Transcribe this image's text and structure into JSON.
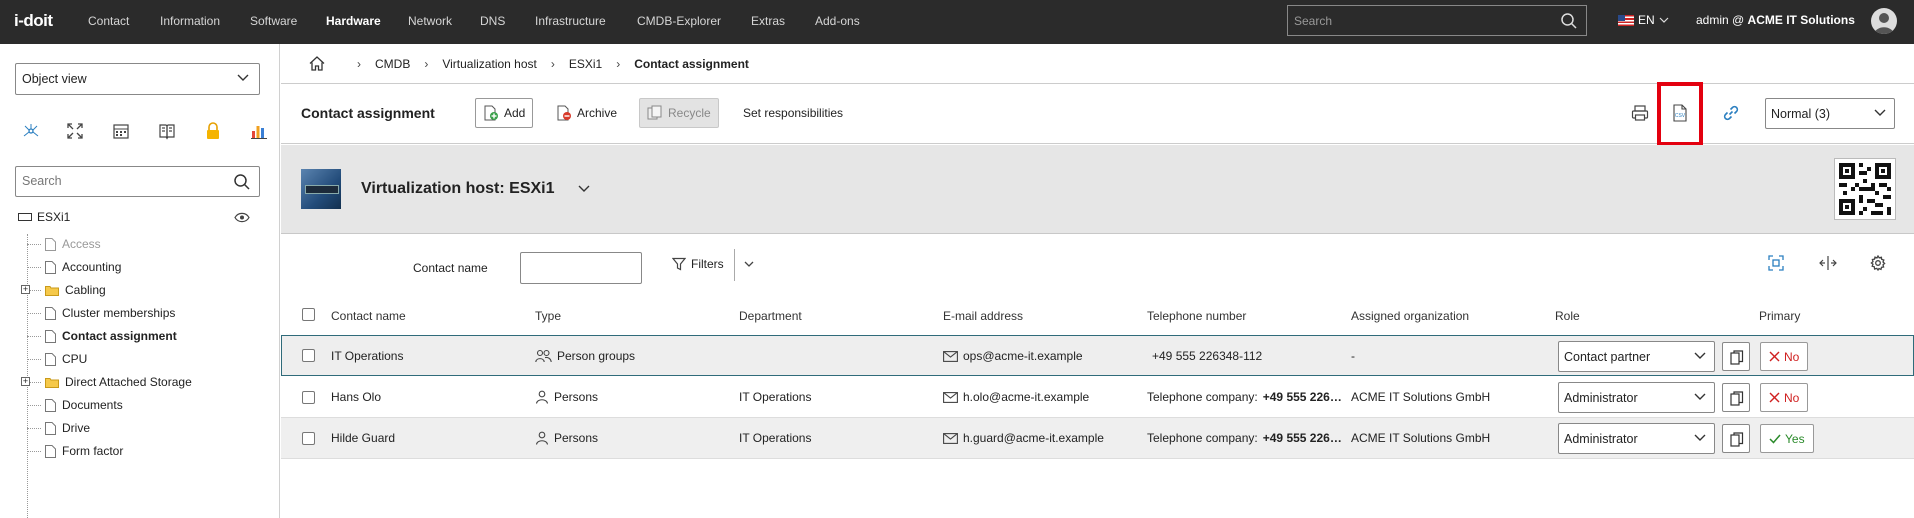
{
  "app": {
    "logo_text": "i-doit"
  },
  "nav": {
    "items": [
      "Contact",
      "Information",
      "Software",
      "Hardware",
      "Network",
      "DNS",
      "Infrastructure",
      "CMDB-Explorer",
      "Extras",
      "Add-ons"
    ],
    "active": "Hardware",
    "search_placeholder": "Search",
    "language": "EN",
    "user_prefix": "admin @",
    "tenant": "ACME IT Solutions"
  },
  "sidebar": {
    "view_select": "Object view",
    "search_placeholder": "Search",
    "root": "ESXi1",
    "items": [
      {
        "label": "Access",
        "state": "grey"
      },
      {
        "label": "Accounting",
        "state": "normal"
      },
      {
        "label": "Cabling",
        "state": "folder"
      },
      {
        "label": "Cluster memberships",
        "state": "normal"
      },
      {
        "label": "Contact assignment",
        "state": "bold"
      },
      {
        "label": "CPU",
        "state": "normal"
      },
      {
        "label": "Direct Attached Storage",
        "state": "folder"
      },
      {
        "label": "Documents",
        "state": "normal"
      },
      {
        "label": "Drive",
        "state": "normal"
      },
      {
        "label": "Form factor",
        "state": "normal"
      }
    ]
  },
  "breadcrumb": [
    "CMDB",
    "Virtualization host",
    "ESXi1",
    "Contact assignment"
  ],
  "toolbar": {
    "title": "Contact assignment",
    "add": "Add",
    "archive": "Archive",
    "recycle": "Recycle",
    "set_responsibilities": "Set responsibilities",
    "csv_label": "CSV",
    "mode": "Normal (3)"
  },
  "object": {
    "title": "Virtualization host: ESXi1"
  },
  "filter": {
    "label": "Contact name",
    "value": "",
    "filters_label": "Filters"
  },
  "table": {
    "columns": [
      "Contact name",
      "Type",
      "Department",
      "E-mail address",
      "Telephone number",
      "Assigned organization",
      "Role",
      "Primary"
    ],
    "rows": [
      {
        "name": "IT Operations",
        "type": "Person groups",
        "department": "",
        "email": "ops@acme-it.example",
        "phone_prefix": "",
        "phone": "+49 555 226348-112",
        "org": "-",
        "role": "Contact partner",
        "primary": "No"
      },
      {
        "name": "Hans Olo",
        "type": "Persons",
        "department": "IT Operations",
        "email": "h.olo@acme-it.example",
        "phone_prefix": "Telephone company: ",
        "phone": "+49 555 226…",
        "org": "ACME IT Solutions GmbH",
        "role": "Administrator",
        "primary": "No"
      },
      {
        "name": "Hilde Guard",
        "type": "Persons",
        "department": "IT Operations",
        "email": "h.guard@acme-it.example",
        "phone_prefix": "Telephone company: ",
        "phone": "+49 555 226…",
        "org": "ACME IT Solutions GmbH",
        "role": "Administrator",
        "primary": "Yes"
      }
    ]
  },
  "colors": {
    "topbar": "#2b2b2b",
    "highlight": "#e3000f",
    "no": "#d02020",
    "yes": "#2a8a2a",
    "selected_row_border": "#2f6b7a"
  }
}
